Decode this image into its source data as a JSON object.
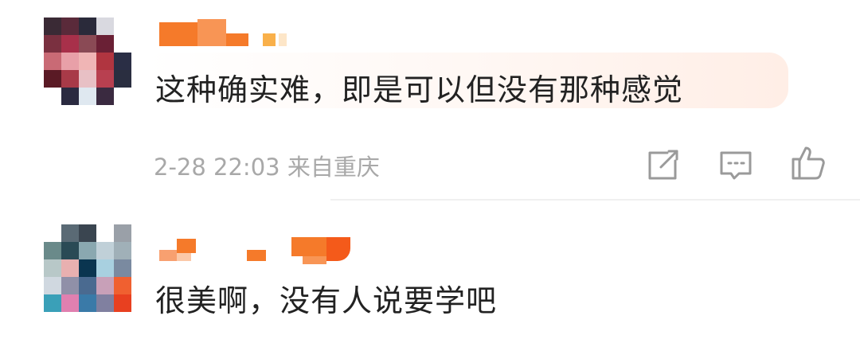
{
  "comments": [
    {
      "text": "这种确实难，即是可以但没有那种感觉",
      "timestamp": "2-28 22:03",
      "location": "来自重庆",
      "highlighted": true
    },
    {
      "text": "很美啊，没有人说要学吧"
    }
  ],
  "actions": {
    "share_icon": "share-icon",
    "reply_icon": "comment-icon",
    "like_icon": "thumbs-up-icon"
  },
  "colors": {
    "text": "#222222",
    "meta": "#a8a8a8",
    "username_orange": "#f57a2a",
    "bubble_tint": "#ffeee6"
  }
}
